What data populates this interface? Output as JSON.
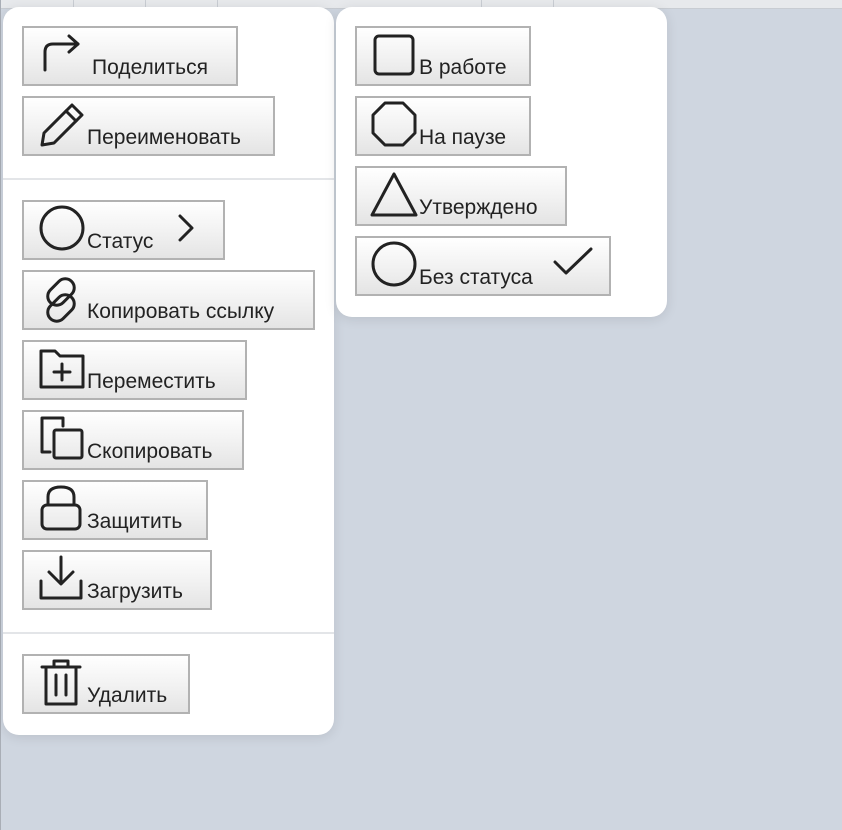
{
  "main_menu": {
    "share_label": "Поделиться",
    "rename_label": "Переименовать",
    "status_label": "Статус",
    "copy_link_label": "Копировать ссылку",
    "move_label": "Переместить",
    "duplicate_label": "Скопировать",
    "protect_label": "Защитить",
    "download_label": "Загрузить",
    "delete_label": "Удалить"
  },
  "status_menu": {
    "options": [
      {
        "label": "В работе",
        "icon": "square-icon",
        "selected": false
      },
      {
        "label": "На паузе",
        "icon": "octagon-icon",
        "selected": false
      },
      {
        "label": "Утверждено",
        "icon": "triangle-icon",
        "selected": false
      },
      {
        "label": "Без статуса",
        "icon": "circle-icon",
        "selected": true
      }
    ]
  },
  "icons": {
    "share": "share-arrow-icon",
    "rename": "pencil-icon",
    "status": "circle-icon",
    "status_submenu": "chevron-right-icon",
    "copy_link": "link-icon",
    "move": "folder-plus-icon",
    "duplicate": "copy-icon",
    "protect": "lock-icon",
    "download": "download-icon",
    "delete": "trash-icon",
    "selected_marker": "checkmark-icon"
  },
  "colors": {
    "backdrop": "#cfd6e0",
    "menu_background": "#ffffff",
    "button_border": "#b2b2b2",
    "icon_stroke": "#222222"
  }
}
